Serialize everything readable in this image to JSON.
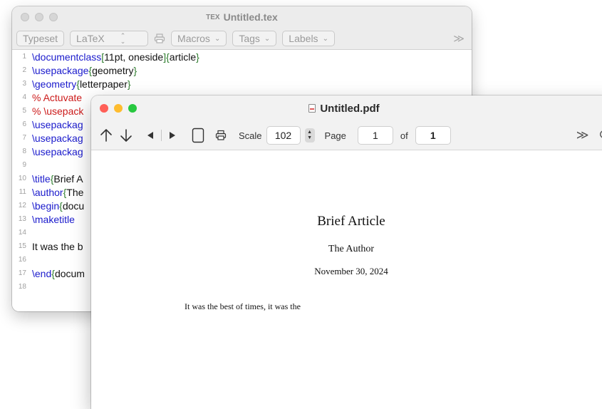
{
  "tex_window": {
    "title": "Untitled.tex",
    "file_icon": "TEX",
    "toolbar": {
      "typeset_label": "Typeset",
      "engine_value": "LaTeX",
      "macros_label": "Macros",
      "tags_label": "Tags",
      "labels_label": "Labels",
      "more": "≫"
    },
    "lines": [
      {
        "n": "1",
        "segs": [
          {
            "t": "\\documentclass",
            "c": "cmd"
          },
          {
            "t": "[",
            "c": "brace"
          },
          {
            "t": "11pt, oneside",
            "c": "txt"
          },
          {
            "t": "]{",
            "c": "brace"
          },
          {
            "t": "article",
            "c": "txt"
          },
          {
            "t": "}",
            "c": "brace"
          }
        ]
      },
      {
        "n": "2",
        "segs": [
          {
            "t": "\\usepackage",
            "c": "cmd"
          },
          {
            "t": "{",
            "c": "brace"
          },
          {
            "t": "geometry",
            "c": "txt"
          },
          {
            "t": "}",
            "c": "brace"
          }
        ]
      },
      {
        "n": "3",
        "segs": [
          {
            "t": "\\geometry",
            "c": "cmd"
          },
          {
            "t": "{",
            "c": "brace"
          },
          {
            "t": "letterpaper",
            "c": "txt"
          },
          {
            "t": "}",
            "c": "brace"
          }
        ]
      },
      {
        "n": "4",
        "segs": [
          {
            "t": "% Actuvate",
            "c": "comment"
          }
        ]
      },
      {
        "n": "5",
        "segs": [
          {
            "t": "% \\usepack",
            "c": "comment"
          }
        ]
      },
      {
        "n": "6",
        "segs": [
          {
            "t": "\\usepackag",
            "c": "cmd"
          }
        ]
      },
      {
        "n": "7",
        "segs": [
          {
            "t": "\\usepackag",
            "c": "cmd"
          }
        ]
      },
      {
        "n": "8",
        "segs": [
          {
            "t": "\\usepackag",
            "c": "cmd"
          }
        ]
      },
      {
        "n": "9",
        "segs": []
      },
      {
        "n": "10",
        "segs": [
          {
            "t": "\\title",
            "c": "cmd"
          },
          {
            "t": "{",
            "c": "brace"
          },
          {
            "t": "Brief A",
            "c": "txt"
          }
        ]
      },
      {
        "n": "11",
        "segs": [
          {
            "t": "\\author",
            "c": "cmd"
          },
          {
            "t": "{",
            "c": "brace"
          },
          {
            "t": "The",
            "c": "txt"
          }
        ]
      },
      {
        "n": "12",
        "segs": [
          {
            "t": "\\begin",
            "c": "cmd"
          },
          {
            "t": "{",
            "c": "brace"
          },
          {
            "t": "docu",
            "c": "txt"
          }
        ]
      },
      {
        "n": "13",
        "segs": [
          {
            "t": "\\maketitle",
            "c": "cmd"
          }
        ]
      },
      {
        "n": "14",
        "segs": []
      },
      {
        "n": "15",
        "segs": [
          {
            "t": "It was the b",
            "c": "txt"
          }
        ]
      },
      {
        "n": "16",
        "segs": []
      },
      {
        "n": "17",
        "segs": [
          {
            "t": "\\end",
            "c": "cmd"
          },
          {
            "t": "{",
            "c": "brace"
          },
          {
            "t": "docum",
            "c": "txt"
          }
        ]
      },
      {
        "n": "18",
        "segs": []
      }
    ]
  },
  "pdf_window": {
    "title": "Untitled.pdf",
    "toolbar": {
      "scale_label": "Scale",
      "scale_value": "102",
      "page_label": "Page",
      "page_value": "1",
      "of_label": "of",
      "total_pages": "1",
      "more": "≫"
    },
    "document": {
      "title": "Brief Article",
      "author": "The Author",
      "date": "November 30, 2024",
      "body": "It was the best of times, it was the"
    }
  },
  "colors": {
    "command": "#1a1acc",
    "brace": "#2e7d2e",
    "comment": "#cc1a1a",
    "close": "#ff5f57",
    "minimize": "#febc2e",
    "zoom": "#28c840"
  }
}
